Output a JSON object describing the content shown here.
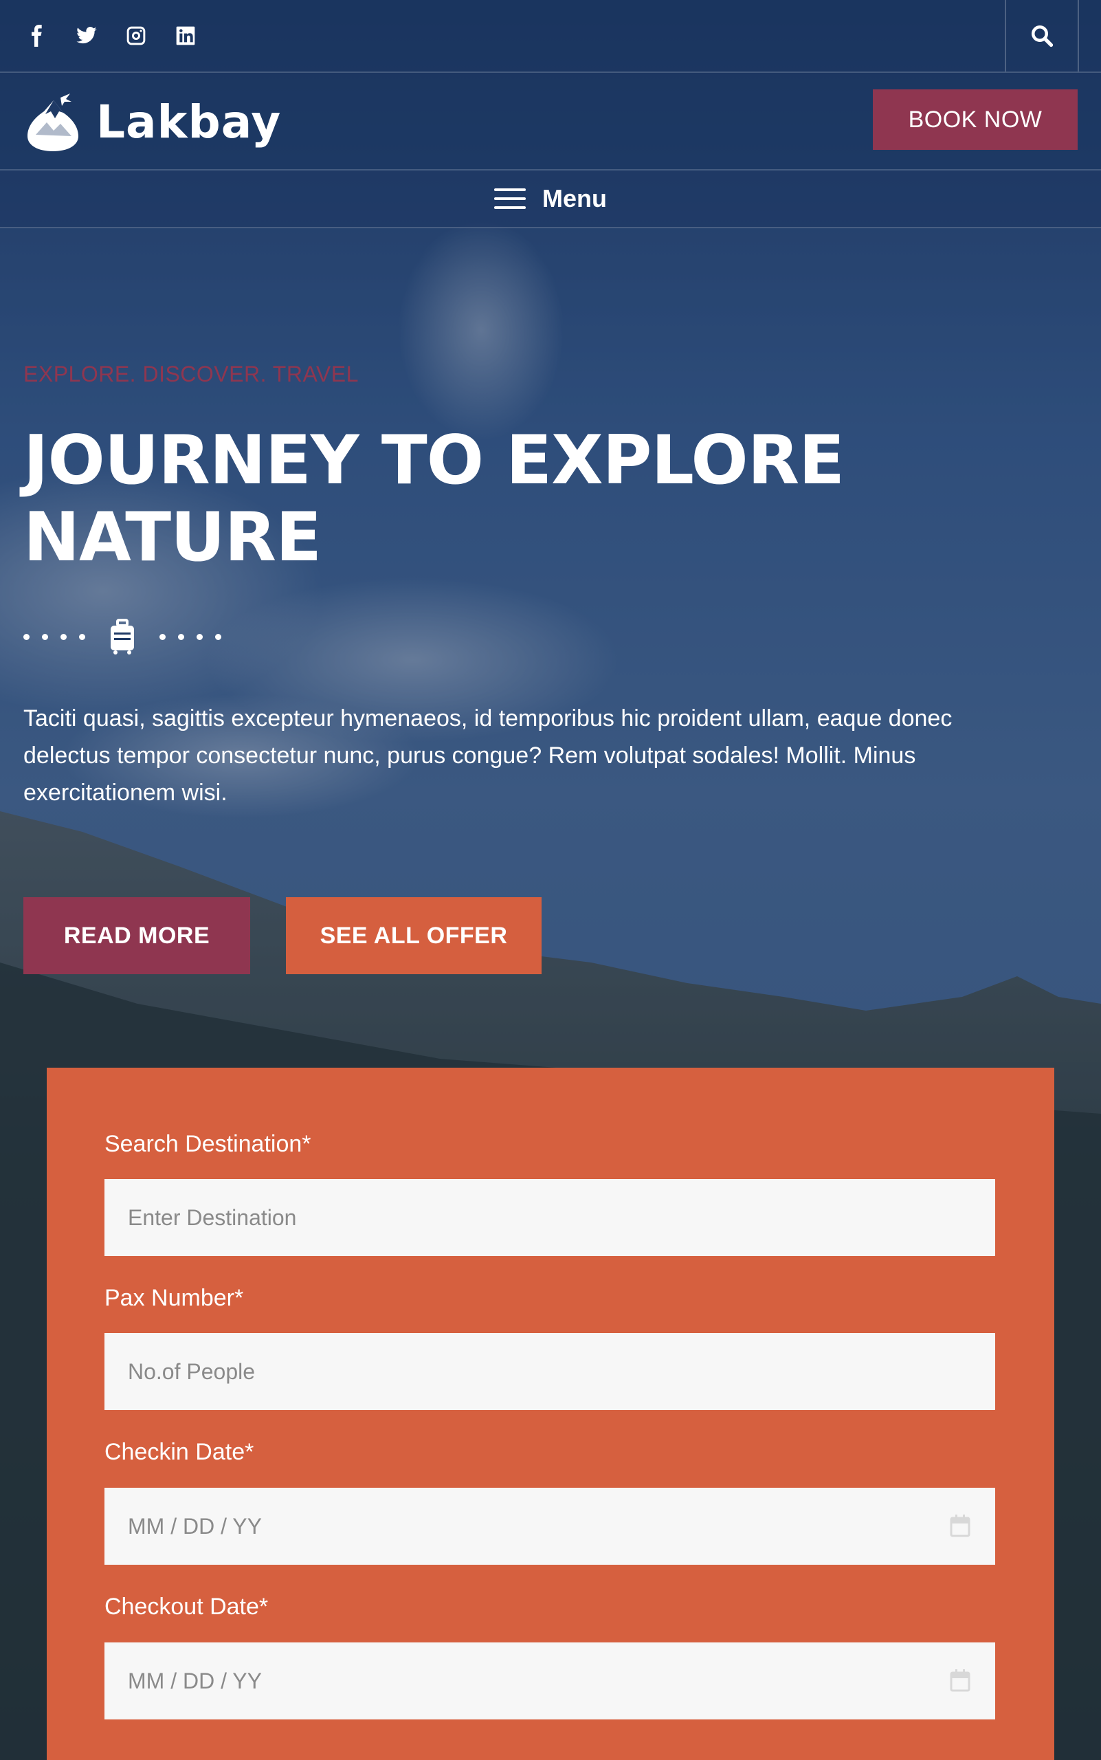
{
  "topbar": {
    "socials": [
      {
        "icon": "facebook-icon"
      },
      {
        "icon": "twitter-icon"
      },
      {
        "icon": "instagram-icon"
      },
      {
        "icon": "linkedin-icon"
      }
    ],
    "search_icon": "search-icon"
  },
  "header": {
    "logo_text": "Lakbay",
    "book_now_label": "BOOK NOW"
  },
  "menu": {
    "label": "Menu"
  },
  "hero": {
    "tagline": "EXPLORE. DISCOVER. TRAVEL",
    "title": "JOURNEY TO EXPLORE NATURE",
    "text": "Taciti quasi, sagittis excepteur hymenaeos, id temporibus hic proident ullam, eaque donec delectus tempor consectetur nunc, purus congue? Rem volutpat sodales! Mollit. Minus exercitationem wisi.",
    "read_more_label": "READ MORE",
    "see_all_offer_label": "SEE ALL OFFER"
  },
  "form": {
    "destination_label": "Search Destination*",
    "destination_placeholder": "Enter Destination",
    "pax_label": "Pax Number*",
    "pax_placeholder": "No.of People",
    "checkin_label": "Checkin Date*",
    "checkin_placeholder": "MM / DD / YY",
    "checkout_label": "Checkout Date*",
    "checkout_placeholder": "MM / DD / YY"
  },
  "colors": {
    "primary_navy": "#1f3a66",
    "accent_burgundy": "#8f3650",
    "accent_orange": "#d55f3f"
  }
}
